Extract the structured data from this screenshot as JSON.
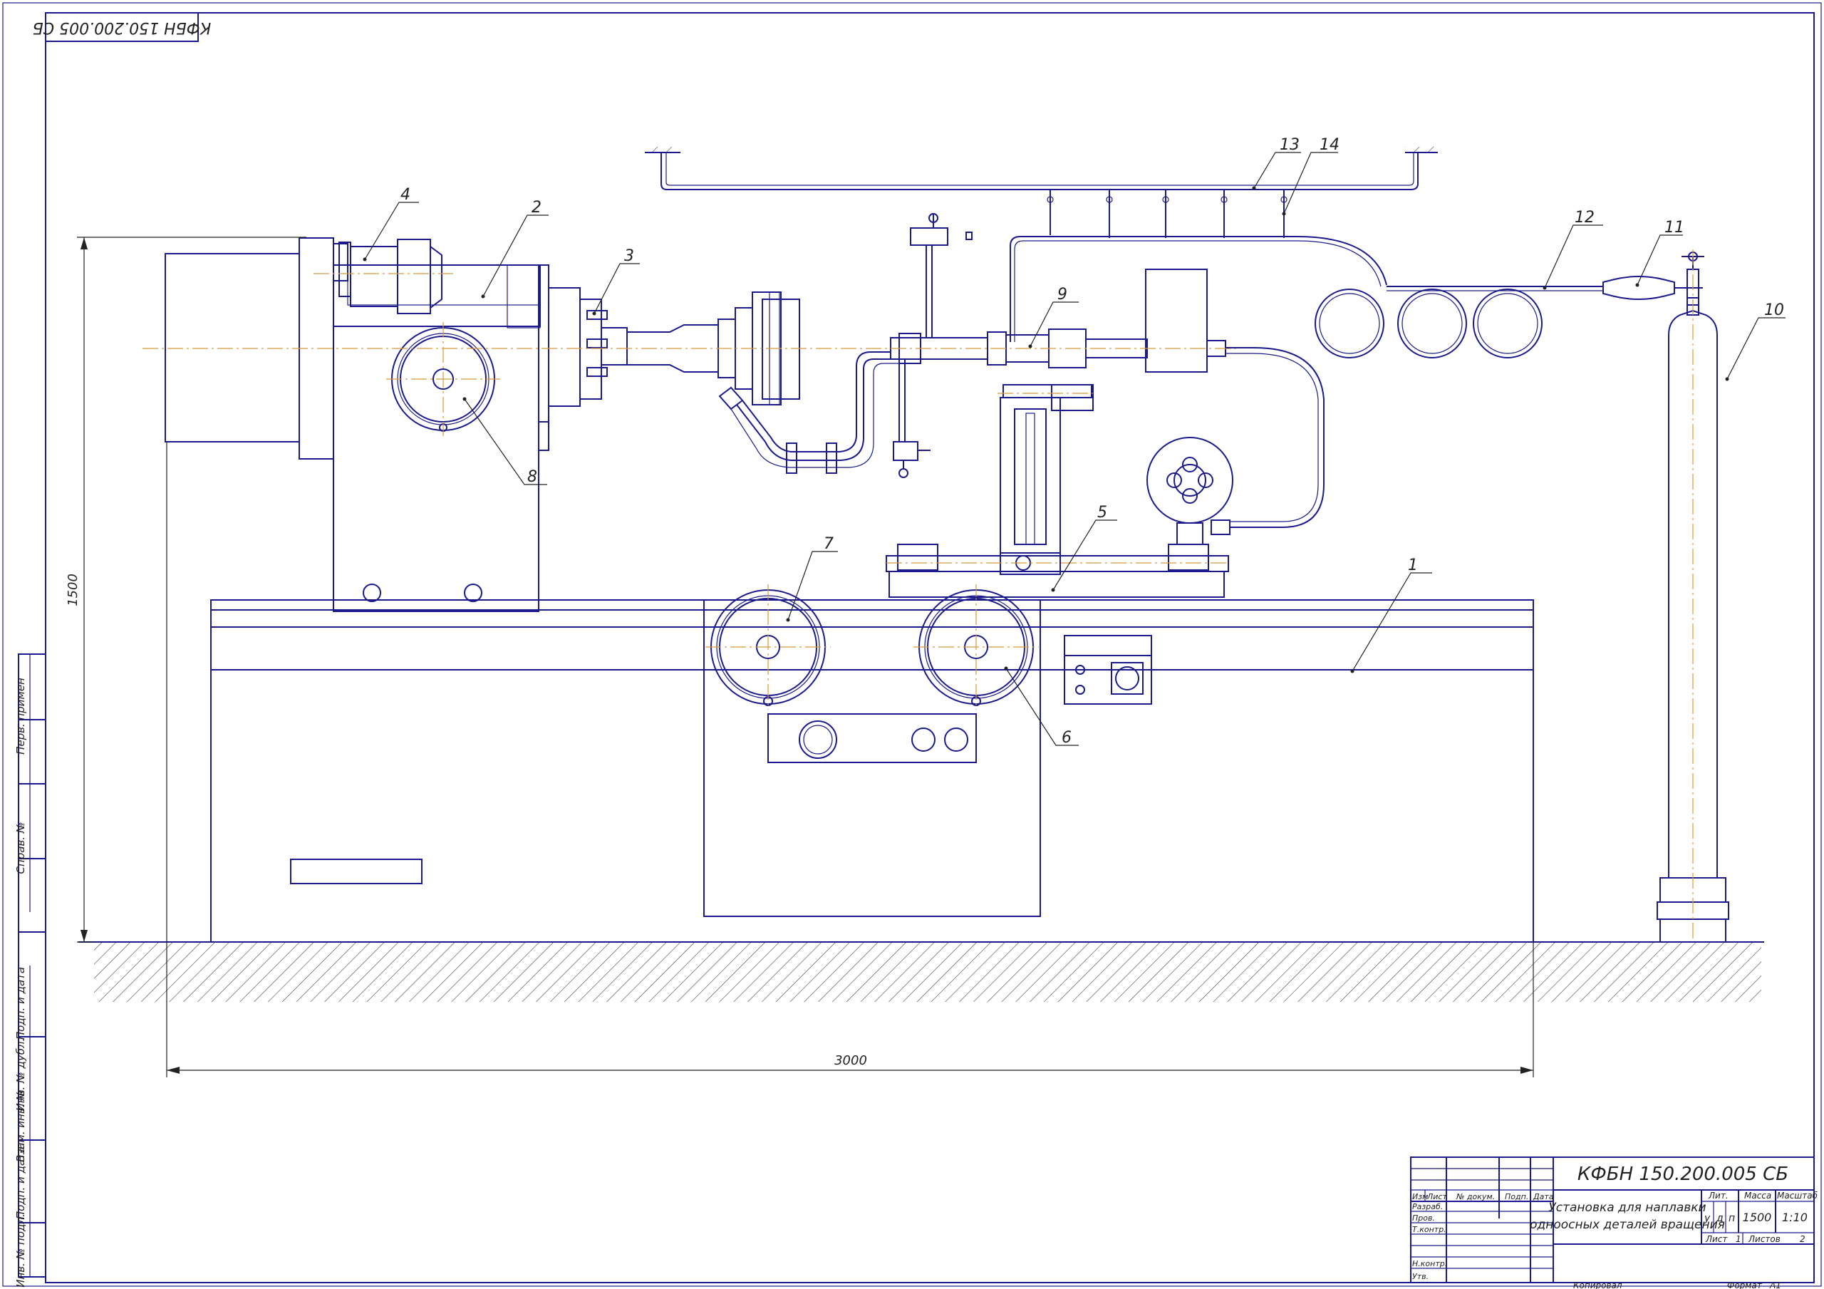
{
  "drawing": {
    "code_top": "КФБН 150.200.005 СБ",
    "dim_height": "1500",
    "dim_width": "3000",
    "callouts": [
      "1",
      "2",
      "3",
      "4",
      "5",
      "6",
      "7",
      "8",
      "9",
      "10",
      "11",
      "12",
      "13",
      "14"
    ],
    "side_labels": [
      "Перв. примен",
      "Справ. №",
      "Подп. и дата",
      "Инв. № дубл.",
      "Взам. инв. №",
      "Подп. и дата",
      "Инв. № подл."
    ]
  },
  "title_block": {
    "code": "КФБН 150.200.005 СБ",
    "title_line1": "Установка для наплавки",
    "title_line2": "одноосных деталей вращения",
    "col_izm": "Изм",
    "col_list": "Лист",
    "col_ndoc": "№ докум.",
    "col_podp": "Подп.",
    "col_data": "Дата",
    "row_razrab": "Разраб.",
    "row_prov": "Пров.",
    "row_tkontr": "Т.контр.",
    "row_nkontr": "Н.контр.",
    "row_utv": "Утв.",
    "lit_label": "Лит.",
    "lit_u": "у",
    "lit_d": "д",
    "lit_p": "п",
    "mass_label": "Масса",
    "mass_value": "1500",
    "scale_label": "Масштаб",
    "scale_value": "1:10",
    "sheet_label": "Лист",
    "sheet_value": "1",
    "sheets_label": "Листов",
    "sheets_value": "2",
    "copied": "Копировал",
    "format_label": "Формат",
    "format_value": "А1"
  }
}
